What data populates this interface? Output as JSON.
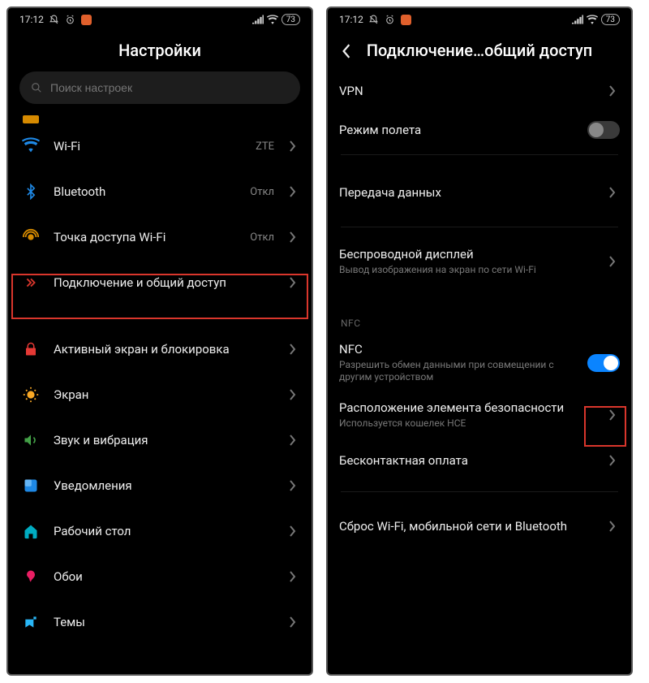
{
  "status": {
    "time": "17:12",
    "battery": "73"
  },
  "left": {
    "title": "Настройки",
    "search_placeholder": "Поиск настроек",
    "rows": {
      "wifi": {
        "label": "Wi-Fi",
        "value": "ZTE"
      },
      "bluetooth": {
        "label": "Bluetooth",
        "value": "Откл"
      },
      "hotspot": {
        "label": "Точка доступа Wi-Fi",
        "value": "Откл"
      },
      "sharing": {
        "label": "Подключение и общий доступ"
      },
      "lockscreen": {
        "label": "Активный экран и блокировка"
      },
      "display": {
        "label": "Экран"
      },
      "sound": {
        "label": "Звук и вибрация"
      },
      "notifications": {
        "label": "Уведомления"
      },
      "desktop": {
        "label": "Рабочий стол"
      },
      "wallpaper": {
        "label": "Обои"
      },
      "themes": {
        "label": "Темы"
      }
    }
  },
  "right": {
    "title": "Подключение…общий доступ",
    "rows": {
      "vpn": {
        "label": "VPN"
      },
      "airplane": {
        "label": "Режим полета"
      },
      "data": {
        "label": "Передача данных"
      },
      "wdisplay": {
        "label": "Беспроводной дисплей",
        "sub": "Вывод изображения на экран по сети Wi-Fi"
      },
      "nfc_header": "NFC",
      "nfc": {
        "label": "NFC",
        "sub": "Разрешить обмен данными при совмещении с другим устройством"
      },
      "secure": {
        "label": "Расположение элемента безопасности",
        "sub": "Используется кошелек HCE"
      },
      "contactless": {
        "label": "Бесконтактная оплата"
      },
      "reset": {
        "label": "Сброс Wi-Fi, мобильной сети и Bluetooth"
      }
    }
  }
}
